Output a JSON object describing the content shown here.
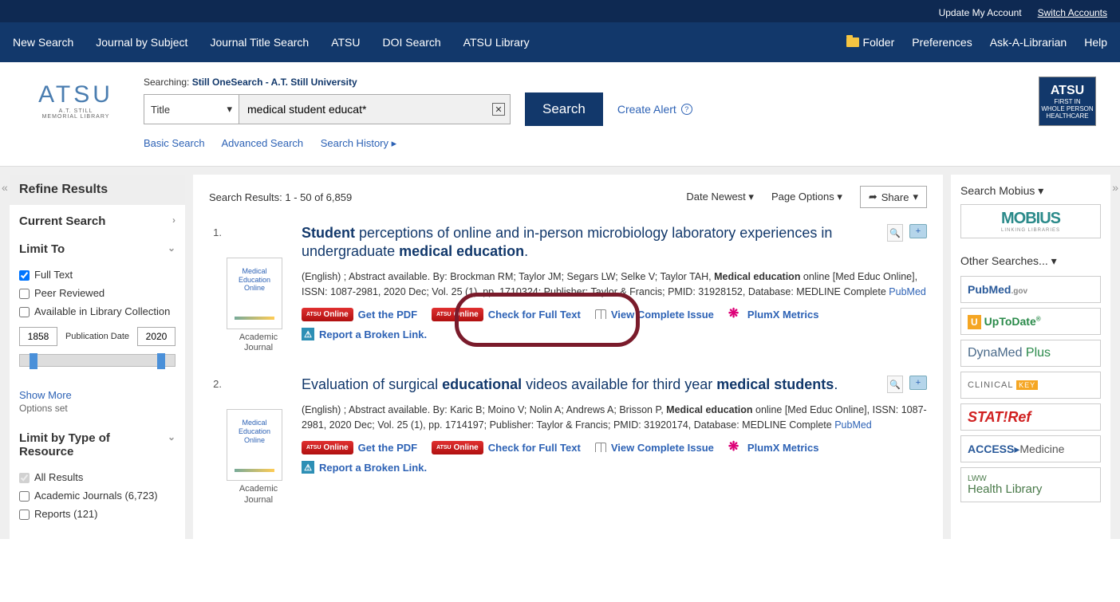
{
  "top": {
    "update": "Update My Account",
    "switch": "Switch Accounts"
  },
  "nav": {
    "items": [
      "New Search",
      "Journal by Subject",
      "Journal Title Search",
      "ATSU",
      "DOI Search",
      "ATSU Library"
    ],
    "right": {
      "folder": "Folder",
      "prefs": "Preferences",
      "ask": "Ask-A-Librarian",
      "help": "Help"
    }
  },
  "logo": {
    "big": "ATSU",
    "line1": "A.T. STILL",
    "line2": "MEMORIAL LIBRARY"
  },
  "search": {
    "searching_prefix": "Searching:",
    "searching_db": "Still OneSearch - A.T. Still University",
    "field": "Title",
    "query": "medical student educat*",
    "button": "Search",
    "create_alert": "Create Alert",
    "links": {
      "basic": "Basic Search",
      "advanced": "Advanced Search",
      "history": "Search History"
    }
  },
  "refine": {
    "header": "Refine Results",
    "current": "Current Search",
    "limit_to": "Limit To",
    "full_text": "Full Text",
    "peer": "Peer Reviewed",
    "avail": "Available in Library Collection",
    "year_from": "1858",
    "year_to": "2020",
    "pub_date": "Publication Date",
    "show_more": "Show More",
    "options_set": "Options set",
    "limit_type": "Limit by Type of Resource",
    "all_results": "All Results",
    "academic_journals": "Academic Journals (6,723)",
    "reports": "Reports (121)"
  },
  "results_bar": {
    "count": "Search Results: 1 - 50 of 6,859",
    "sort": "Date Newest",
    "page_opts": "Page Options",
    "share": "Share"
  },
  "results": [
    {
      "num": "1.",
      "title_pre": "Student",
      "title_mid": " perceptions of online and in-person microbiology laboratory experiences in undergraduate ",
      "title_bold2": "medical education",
      "title_post": ".",
      "meta1": "(English) ; Abstract available. By: Brockman RM; Taylor JM; Segars LW; Selke V; Taylor TAH, ",
      "meta_bold": "Medical education",
      "meta2": " online [Med Educ Online], ISSN: 1087-2981, 2020 Dec; Vol. 25 (1), pp. 1710324; Publisher: Taylor & Francis; PMID: 31928152, Database: MEDLINE Complete ",
      "pubmed": "PubMed",
      "thumb_text": "Medical Education Online",
      "thumb_label": "Academic Journal"
    },
    {
      "num": "2.",
      "title_pre": "",
      "title_mid": "Evaluation of surgical ",
      "title_bold1": "educational",
      "title_mid2": " videos available for third year ",
      "title_bold2": "medical students",
      "title_post": ".",
      "meta1": "(English) ; Abstract available. By: Karic B; Moino V; Nolin A; Andrews A; Brisson P, ",
      "meta_bold": "Medical education",
      "meta2": " online [Med Educ Online], ISSN: 1087-2981, 2020 Dec; Vol. 25 (1), pp. 1714197; Publisher: Taylor & Francis; PMID: 31920174, Database: MEDLINE Complete ",
      "pubmed": "PubMed",
      "thumb_text": "Medical Education Online",
      "thumb_label": "Academic Journal"
    }
  ],
  "actions": {
    "get_pdf": "Get the PDF",
    "check_full": "Check for Full Text",
    "view_issue": "View Complete Issue",
    "plumx": "PlumX Metrics",
    "broken": "Report a Broken Link."
  },
  "right": {
    "search_mobius": "Search Mobius",
    "mobius": "MOBIUS",
    "mobius_sub": "LINKING LIBRARIES",
    "other": "Other Searches...",
    "pubmed": "PubMed",
    "pubmed_gov": ".gov",
    "uptodate": "UpToDate",
    "dynamed": "DynaMed ",
    "dynamed_plus": "Plus",
    "clinicalkey": "CLINICAL",
    "clinicalkey_key": "KEY",
    "statref": "STAT!Ref",
    "access": "ACCESS",
    "access_med": "Medicine",
    "lww_top": "LWW",
    "lww_bot": "Health Library"
  }
}
